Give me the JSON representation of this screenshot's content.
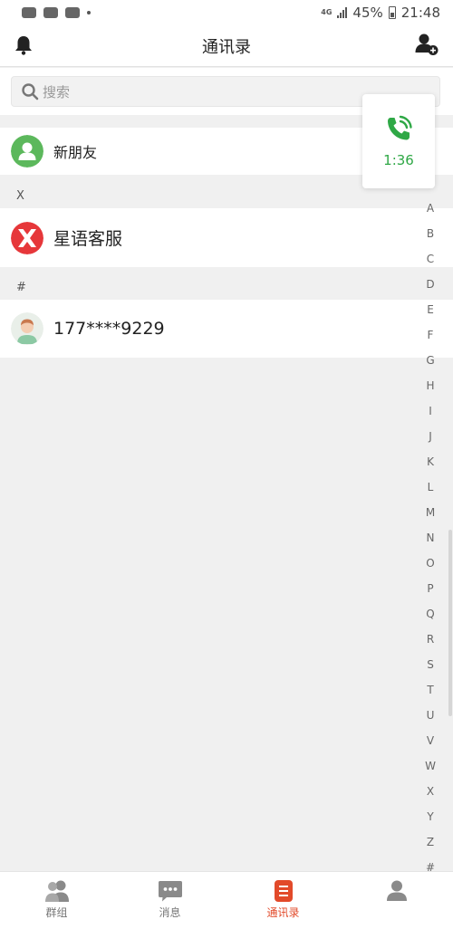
{
  "status_bar": {
    "network": "4G",
    "battery": "45%",
    "time": "21:48"
  },
  "header": {
    "title": "通讯录"
  },
  "search": {
    "placeholder": "搜索"
  },
  "new_friends": {
    "label": "新朋友"
  },
  "sections": [
    {
      "letter": "X",
      "contacts": [
        {
          "name": "星语客服",
          "avatar": "x-logo-icon"
        }
      ]
    },
    {
      "letter": "#",
      "contacts": [
        {
          "name": "177****9229",
          "avatar": "person-avatar"
        }
      ]
    }
  ],
  "call_widget": {
    "duration": "1:36",
    "color": "#2fa846"
  },
  "alpha_index": [
    "A",
    "B",
    "C",
    "D",
    "E",
    "F",
    "G",
    "H",
    "I",
    "J",
    "K",
    "L",
    "M",
    "N",
    "O",
    "P",
    "Q",
    "R",
    "S",
    "T",
    "U",
    "V",
    "W",
    "X",
    "Y",
    "Z",
    "#"
  ],
  "tabs": [
    {
      "label": "群组",
      "icon": "group-icon",
      "active": false
    },
    {
      "label": "消息",
      "icon": "message-icon",
      "active": false
    },
    {
      "label": "通讯录",
      "icon": "contacts-icon",
      "active": true
    },
    {
      "label": "",
      "icon": "profile-icon",
      "active": false
    }
  ],
  "colors": {
    "accent": "#e24a2a",
    "green": "#2fa846"
  }
}
